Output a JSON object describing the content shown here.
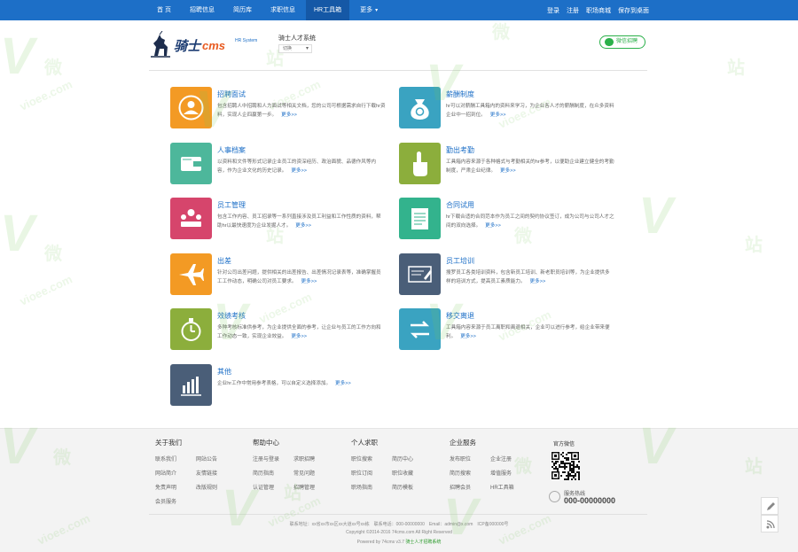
{
  "nav": {
    "items": [
      "首 页",
      "招聘信息",
      "简历库",
      "求职信息",
      "HR工具箱",
      "更多"
    ],
    "active_index": 4,
    "right_links": [
      "登录",
      "注册",
      "职场商城",
      "保存到桌面"
    ]
  },
  "header": {
    "logo_text": "骑士",
    "logo_cms": "cms",
    "logo_sub": "HR System",
    "site_name": "骑士人才系统",
    "switch_label": "切换",
    "wechat_button": "微信招聘"
  },
  "modules": [
    {
      "title": "招聘面试",
      "desc": "包含招聘人中招聘和人力面试等相关文档，您的公司可根据需求自行下载hr资料，实现人企四赢第一步。",
      "more": "更多>>",
      "color": "#f39a24",
      "icon": "user-circle-icon"
    },
    {
      "title": "薪酬制度",
      "desc": "hr可以对薪酬工具箱内的资料来学习，为企业各人才的薪酬制度，在众多资料企业中一招到位。",
      "more": "更多>>",
      "color": "#3aa3c1",
      "icon": "money-bag-icon"
    },
    {
      "title": "人事档案",
      "desc": "以资料和文件等形式记录企业员工的资深经历、政治面貌、品德作风等内容，作为企业文化的历史记录。",
      "more": "更多>>",
      "color": "#4db79b",
      "icon": "wallet-icon"
    },
    {
      "title": "勤出考勤",
      "desc": "工具箱内容来源于各种格式与考勤相关的hr参考，以便助企业建立健全的考勤制度，严肃企业纪律。",
      "more": "更多>>",
      "color": "#8cae3c",
      "icon": "hand-pointer-icon"
    },
    {
      "title": "员工管理",
      "desc": "包含工作内容、员工招录等一系列直接涉及员工利益和工作性质的资料，帮助hr以最快速度为企业发掘人才。",
      "more": "更多>>",
      "color": "#d6456c",
      "icon": "meeting-icon"
    },
    {
      "title": "合同试用",
      "desc": "hr下载合适的合同范本作为员工之间的契约协议签订，成为公司与公司人才之间的双向选择。",
      "more": "更多>>",
      "color": "#33b38d",
      "icon": "contract-icon"
    },
    {
      "title": "出差",
      "desc": "针对公司出差问题，提供相关的出差报告、出差情况记录表等，准确掌握员工工作动态，明确公司对员工要求。",
      "more": "更多>>",
      "color": "#f39a24",
      "icon": "airplane-icon"
    },
    {
      "title": "员工培训",
      "desc": "搜罗员工各类培训资料，包含新员工培训、新老职员培训等，为企业提供多样的培训方式，提高员工素质能力。",
      "more": "更多>>",
      "color": "#4a5e78",
      "icon": "training-icon"
    },
    {
      "title": "效绩考核",
      "desc": "多种考核标准供参考，为企业提供全面的参考，让企业与员工的工作方向和工作动态一致，实现企业效益。",
      "more": "更多>>",
      "color": "#8cae3c",
      "icon": "stopwatch-icon"
    },
    {
      "title": "移交离退",
      "desc": "工具箱内容来源于员工离职和离退相关，企业可以进行参考，给企业带来便利。",
      "more": "更多>>",
      "color": "#3aa3c1",
      "icon": "transfer-icon"
    },
    {
      "title": "其他",
      "desc": "企业hr工作中常用参考表格，可以自定义选择添加。",
      "more": "更多>>",
      "color": "#4a5e78",
      "icon": "bar-chart-icon"
    }
  ],
  "footer": {
    "columns": [
      {
        "title": "关于我们",
        "links": [
          "联系我们",
          "网站公告",
          "网站简介",
          "友情链接",
          "免责声明",
          "改版规则",
          "会员服务"
        ]
      },
      {
        "title": "帮助中心",
        "links": [
          "注册与登录",
          "求职招聘",
          "简历指南",
          "常见问题",
          "认证管理",
          "招聘管理"
        ]
      },
      {
        "title": "个人求职",
        "links": [
          "职位搜索",
          "简历中心",
          "职位订阅",
          "职位收藏",
          "职场指南",
          "简历模板"
        ]
      },
      {
        "title": "企业服务",
        "links": [
          "发布职位",
          "企业注册",
          "简历搜索",
          "增值服务",
          "招聘会员",
          "HR工具箱"
        ]
      }
    ],
    "qr_title": "官方微信",
    "hotline_label": "服务热线",
    "hotline_number": "000-00000000",
    "copy_line1": "联系地址：xx省xx市xx区xx大道xx号xx栋　联系电话：000-00000000　Email：admin@x.com　ICP备000000号",
    "copy_line2": "Copyright ©2014-2016 74cms.com All Right Reserved",
    "copy_line3_prefix": "Powered by 74cms v3.7",
    "copy_line3_suffix": "骑士人才招聘系统"
  },
  "watermark": {
    "text_wei": "微",
    "text_zhan": "站",
    "domain": "vioee.com",
    "letter": "V"
  }
}
